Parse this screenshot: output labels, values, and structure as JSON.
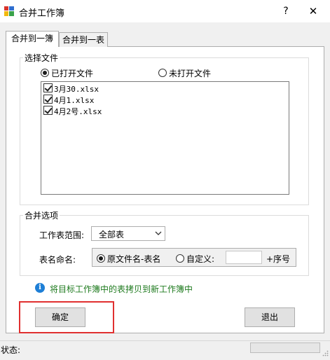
{
  "window": {
    "title": "合并工作簿",
    "help_label": "?",
    "close_label": "✕"
  },
  "tabs": [
    {
      "label": "合并到一簿",
      "active": true
    },
    {
      "label": "合并到一表",
      "active": false
    }
  ],
  "select_file": {
    "group_title": "选择文件",
    "radio_opened": {
      "label": "已打开文件",
      "checked": true
    },
    "radio_unopened": {
      "label": "未打开文件",
      "checked": false
    },
    "files": [
      {
        "name": "3月30.xlsx",
        "checked": true
      },
      {
        "name": "4月1.xlsx",
        "checked": true
      },
      {
        "name": "4月2号.xlsx",
        "checked": true
      }
    ]
  },
  "merge_options": {
    "group_title": "合并选项",
    "sheet_range_label": "工作表范围:",
    "sheet_range_value": "全部表",
    "naming_label": "表名命名:",
    "radio_original": {
      "label": "原文件名-表名",
      "checked": true
    },
    "radio_custom": {
      "label": "自定义:",
      "checked": false
    },
    "custom_value": "",
    "suffix_label": "+序号"
  },
  "info": {
    "text": "将目标工作簿中的表拷贝到新工作簿中",
    "color": "#1e7a1e"
  },
  "buttons": {
    "confirm_label": "确定",
    "exit_label": "退出"
  },
  "status": {
    "label": "状态:"
  },
  "colors": {
    "highlight": "#e03030",
    "info_icon": "#1e7fd6"
  },
  "icons": {
    "app": "app-icon",
    "info": "info-icon",
    "dropdown": "chevron-down-icon"
  }
}
